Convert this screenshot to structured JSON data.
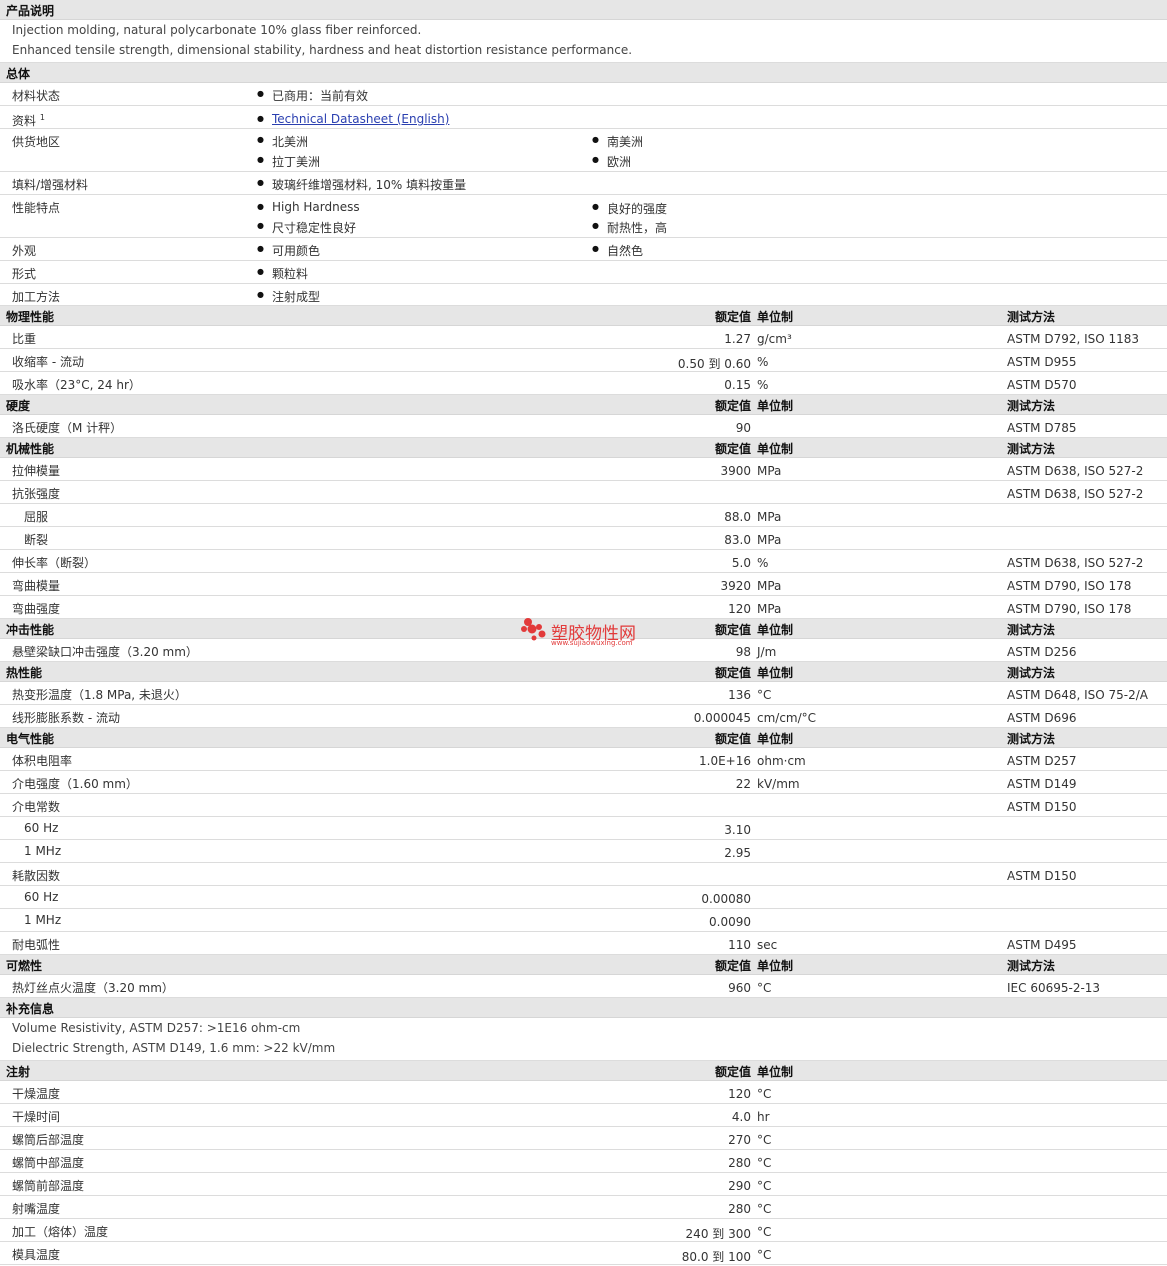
{
  "desc": {
    "title": "产品说明",
    "lines": [
      "Injection molding, natural polycarbonate 10% glass fiber reinforced.",
      "Enhanced tensile strength, dimensional stability, hardness and heat distortion resistance performance."
    ]
  },
  "general": {
    "title": "总体",
    "rows": [
      {
        "label": "材料状态",
        "items": [
          "已商用：当前有效"
        ]
      },
      {
        "label": "资料",
        "sup": "1",
        "link": "Technical Datasheet (English)"
      },
      {
        "label": "供货地区",
        "items": [
          "北美洲",
          "南美洲",
          "拉丁美洲",
          "欧洲"
        ]
      },
      {
        "label": "填料/增强材料",
        "items": [
          "玻璃纤维增强材料, 10% 填料按重量"
        ]
      },
      {
        "label": "性能特点",
        "items": [
          "High Hardness",
          "良好的强度",
          "尺寸稳定性良好",
          "耐热性，高"
        ]
      },
      {
        "label": "外观",
        "items": [
          "可用颜色",
          "自然色"
        ]
      },
      {
        "label": "形式",
        "items": [
          "颗粒料"
        ]
      },
      {
        "label": "加工方法",
        "items": [
          "注射成型"
        ]
      }
    ]
  },
  "columns": {
    "value": "额定值",
    "unit": "单位制",
    "method": "测试方法"
  },
  "physical": {
    "title": "物理性能",
    "rows": [
      {
        "l": "比重",
        "v": "1.27",
        "u": "g/cm³",
        "m": "ASTM D792, ISO 1183"
      },
      {
        "l": "收缩率 - 流动",
        "v": "0.50 到  0.60",
        "u": "%",
        "m": "ASTM D955"
      },
      {
        "l": "吸水率（23°C, 24 hr）",
        "v": "0.15",
        "u": "%",
        "m": "ASTM D570"
      }
    ]
  },
  "hardness": {
    "title": "硬度",
    "rows": [
      {
        "l": "洛氏硬度（M 计秤）",
        "v": "90",
        "u": "",
        "m": "ASTM D785"
      }
    ]
  },
  "mechanical": {
    "title": "机械性能",
    "rows": [
      {
        "l": "拉伸模量",
        "v": "3900",
        "u": "MPa",
        "m": "ASTM D638, ISO 527-2"
      },
      {
        "l": "抗张强度",
        "v": "",
        "u": "",
        "m": "ASTM D638, ISO 527-2"
      },
      {
        "l": "屈服",
        "v": "88.0",
        "u": "MPa",
        "m": ""
      },
      {
        "l": "断裂",
        "v": "83.0",
        "u": "MPa",
        "m": ""
      },
      {
        "l": "伸长率（断裂）",
        "v": "5.0",
        "u": "%",
        "m": "ASTM D638, ISO 527-2"
      },
      {
        "l": "弯曲模量",
        "v": "3920",
        "u": "MPa",
        "m": "ASTM D790, ISO 178"
      },
      {
        "l": "弯曲强度",
        "v": "120",
        "u": "MPa",
        "m": "ASTM D790, ISO 178"
      }
    ]
  },
  "impact": {
    "title": "冲击性能",
    "rows": [
      {
        "l": "悬壁梁缺口冲击强度（3.20 mm）",
        "v": "98",
        "u": "J/m",
        "m": "ASTM D256"
      }
    ]
  },
  "thermal": {
    "title": "热性能",
    "rows": [
      {
        "l": "热变形温度（1.8 MPa, 未退火）",
        "v": "136",
        "u": "°C",
        "m": "ASTM D648, ISO 75-2/A"
      },
      {
        "l": "线形膨胀系数 - 流动",
        "v": "0.000045",
        "u": "cm/cm/°C",
        "m": "ASTM D696"
      }
    ]
  },
  "electrical": {
    "title": "电气性能",
    "rows": [
      {
        "l": "体积电阻率",
        "v": "1.0E+16",
        "u": "ohm·cm",
        "m": "ASTM D257"
      },
      {
        "l": "介电强度（1.60 mm）",
        "v": "22",
        "u": "kV/mm",
        "m": "ASTM D149"
      },
      {
        "l": "介电常数",
        "v": "",
        "u": "",
        "m": "ASTM D150"
      },
      {
        "l": "60 Hz",
        "v": "3.10",
        "u": "",
        "m": ""
      },
      {
        "l": "1 MHz",
        "v": "2.95",
        "u": "",
        "m": ""
      },
      {
        "l": "耗散因数",
        "v": "",
        "u": "",
        "m": "ASTM D150"
      },
      {
        "l": "60 Hz",
        "v": "0.00080",
        "u": "",
        "m": ""
      },
      {
        "l": "1 MHz",
        "v": "0.0090",
        "u": "",
        "m": ""
      },
      {
        "l": "耐电弧性",
        "v": "110",
        "u": "sec",
        "m": "ASTM D495"
      }
    ]
  },
  "flammability": {
    "title": "可燃性",
    "rows": [
      {
        "l": "热灯丝点火温度（3.20 mm）",
        "v": "960",
        "u": "°C",
        "m": "IEC 60695-2-13"
      }
    ]
  },
  "supplement": {
    "title": "补充信息",
    "lines": [
      "Volume Resistivity, ASTM D257: >1E16 ohm-cm",
      "Dielectric Strength, ASTM D149, 1.6 mm: >22 kV/mm"
    ]
  },
  "injection": {
    "title": "注射",
    "rows": [
      {
        "l": "干燥温度",
        "v": "120",
        "u": "°C"
      },
      {
        "l": "干燥时间",
        "v": "4.0",
        "u": "hr"
      },
      {
        "l": "螺筒后部温度",
        "v": "270",
        "u": "°C"
      },
      {
        "l": "螺筒中部温度",
        "v": "280",
        "u": "°C"
      },
      {
        "l": "螺筒前部温度",
        "v": "290",
        "u": "°C"
      },
      {
        "l": "射嘴温度",
        "v": "280",
        "u": "°C"
      },
      {
        "l": "加工（熔体）温度",
        "v": "240 到  300",
        "u": "°C"
      },
      {
        "l": "模具温度",
        "v": "80.0 到  100",
        "u": "°C"
      }
    ]
  },
  "watermark": {
    "name": "塑胶物性网",
    "url": "www.sujiaowuxing.com",
    "color": "#e23a3a"
  }
}
